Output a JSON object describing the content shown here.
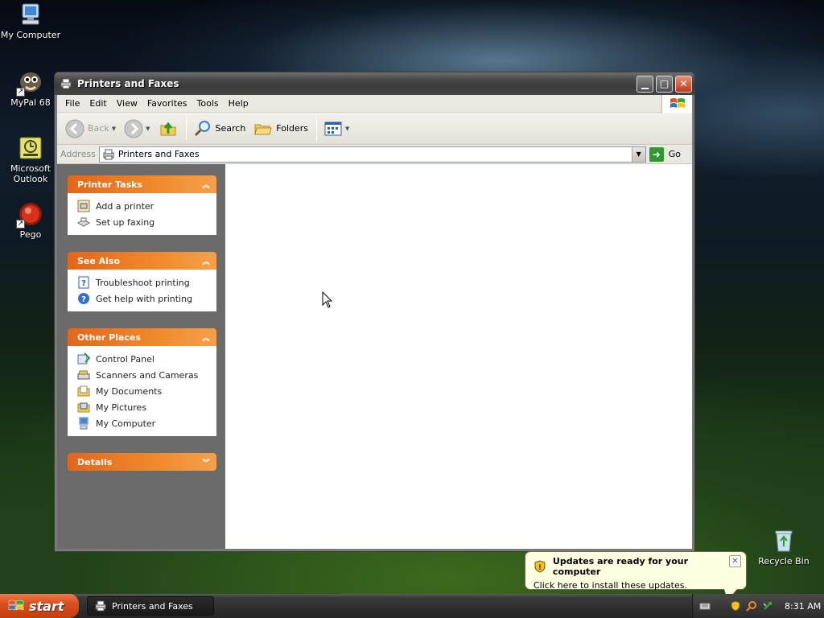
{
  "desktop": {
    "icons": [
      {
        "label": "My Computer",
        "icon": "computer-icon"
      },
      {
        "label": "MyPal 68",
        "icon": "mypal-icon"
      },
      {
        "label": "Microsoft Outlook",
        "icon": "outlook-icon"
      },
      {
        "label": "Pego",
        "icon": "pego-icon"
      }
    ],
    "recycle_bin": "Recycle Bin"
  },
  "window": {
    "title": "Printers and Faxes",
    "menu": [
      "File",
      "Edit",
      "View",
      "Favorites",
      "Tools",
      "Help"
    ],
    "toolbar": {
      "back": "Back",
      "search": "Search",
      "folders": "Folders"
    },
    "address": {
      "label": "Address",
      "value": "Printers and Faxes",
      "go": "Go"
    },
    "panels": [
      {
        "title": "Printer Tasks",
        "items": [
          {
            "label": "Add a printer",
            "icon": "add-printer-icon"
          },
          {
            "label": "Set up faxing",
            "icon": "fax-icon"
          }
        ]
      },
      {
        "title": "See Also",
        "items": [
          {
            "label": "Troubleshoot printing",
            "icon": "help-doc-icon"
          },
          {
            "label": "Get help with printing",
            "icon": "help-icon"
          }
        ]
      },
      {
        "title": "Other Places",
        "items": [
          {
            "label": "Control Panel",
            "icon": "control-panel-icon"
          },
          {
            "label": "Scanners and Cameras",
            "icon": "scanner-icon"
          },
          {
            "label": "My Documents",
            "icon": "documents-icon"
          },
          {
            "label": "My Pictures",
            "icon": "pictures-icon"
          },
          {
            "label": "My Computer",
            "icon": "computer-icon"
          }
        ]
      },
      {
        "title": "Details",
        "items": []
      }
    ]
  },
  "balloon": {
    "title": "Updates are ready for your computer",
    "message": "Click here to install these updates."
  },
  "taskbar": {
    "start": "start",
    "task": "Printers and Faxes",
    "clock": "8:31 AM"
  },
  "colors": {
    "panel_header": "#e2661a",
    "side_pane": "#6b6b6b",
    "titlebar": "#3b3b3b",
    "start_button": "#d8501c",
    "balloon_bg": "#ffffe1"
  }
}
